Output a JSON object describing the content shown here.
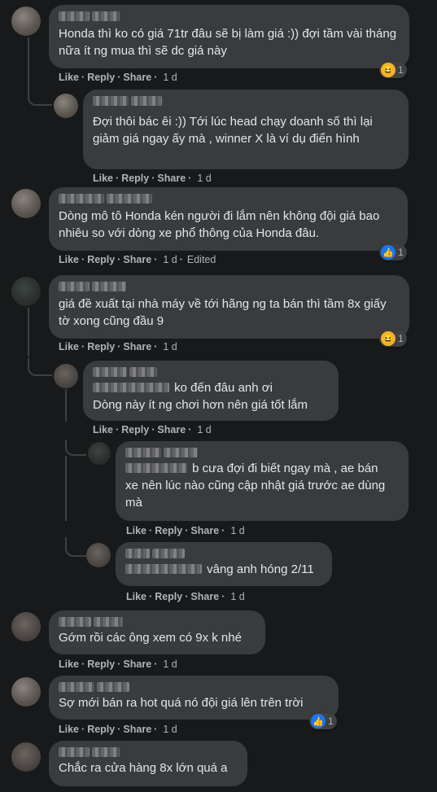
{
  "actions": {
    "like": "Like",
    "reply": "Reply",
    "share": "Share",
    "sep": "·"
  },
  "comments": [
    {
      "text": "Honda thì ko có giá 71tr đâu sẽ bị làm giá :)) đợi tầm vài tháng nữa ít ng mua thì sẽ dc giá này",
      "time": "1 d",
      "reaction": {
        "icon": "haha-icon",
        "count": "1"
      }
    },
    {
      "text": "Đợi thôi bác êi :)) Tới lúc head chạy doanh số thì lại giảm giá ngay ấy mà , winner X là ví dụ điển hình",
      "time": "1 d"
    },
    {
      "text": "Dòng mô tô Honda kén người đi lắm nên không đội giá bao nhiêu so với dòng xe phổ thông của Honda đâu.",
      "time": "1 d",
      "edited": "Edited",
      "reaction": {
        "icon": "like-icon",
        "count": "1"
      }
    },
    {
      "text": "giá đề xuất tại nhà máy về tới hãng ng ta bán thì tầm 8x giấy tờ xong cũng đầu 9",
      "time": "1 d",
      "reaction": {
        "icon": "haha-icon",
        "count": "1"
      }
    },
    {
      "text_inline": "ko đến đâu anh ơi",
      "text_rest": "Dòng này ít ng chơi hơn nên giá tốt lắm",
      "time": "1 d"
    },
    {
      "text_inline": "b cưa đợi đi biết ngay mà , ae bán",
      "text_rest": "xe nên lúc nào cũng cập nhật giá trước ae dùng mà",
      "time": "1 d"
    },
    {
      "text_inline": "vâng anh hóng 2/11",
      "time": "1 d"
    },
    {
      "text": "Gớm rồi các ông xem có 9x k nhé",
      "time": "1 d"
    },
    {
      "text": "Sợ mới bán ra hot quá nó đội giá lên trên trời",
      "time": "1 d",
      "reaction": {
        "icon": "like-icon",
        "count": "1"
      }
    },
    {
      "text": "Chắc ra cửa hàng 8x lớn quá a"
    }
  ],
  "colors": {
    "background": "#18191a",
    "bubble": "#3a3b3c",
    "text": "#e4e6eb",
    "secondary": "#b0b3b8",
    "like_blue": "#1877f2",
    "haha_yellow": "#f7b125"
  }
}
